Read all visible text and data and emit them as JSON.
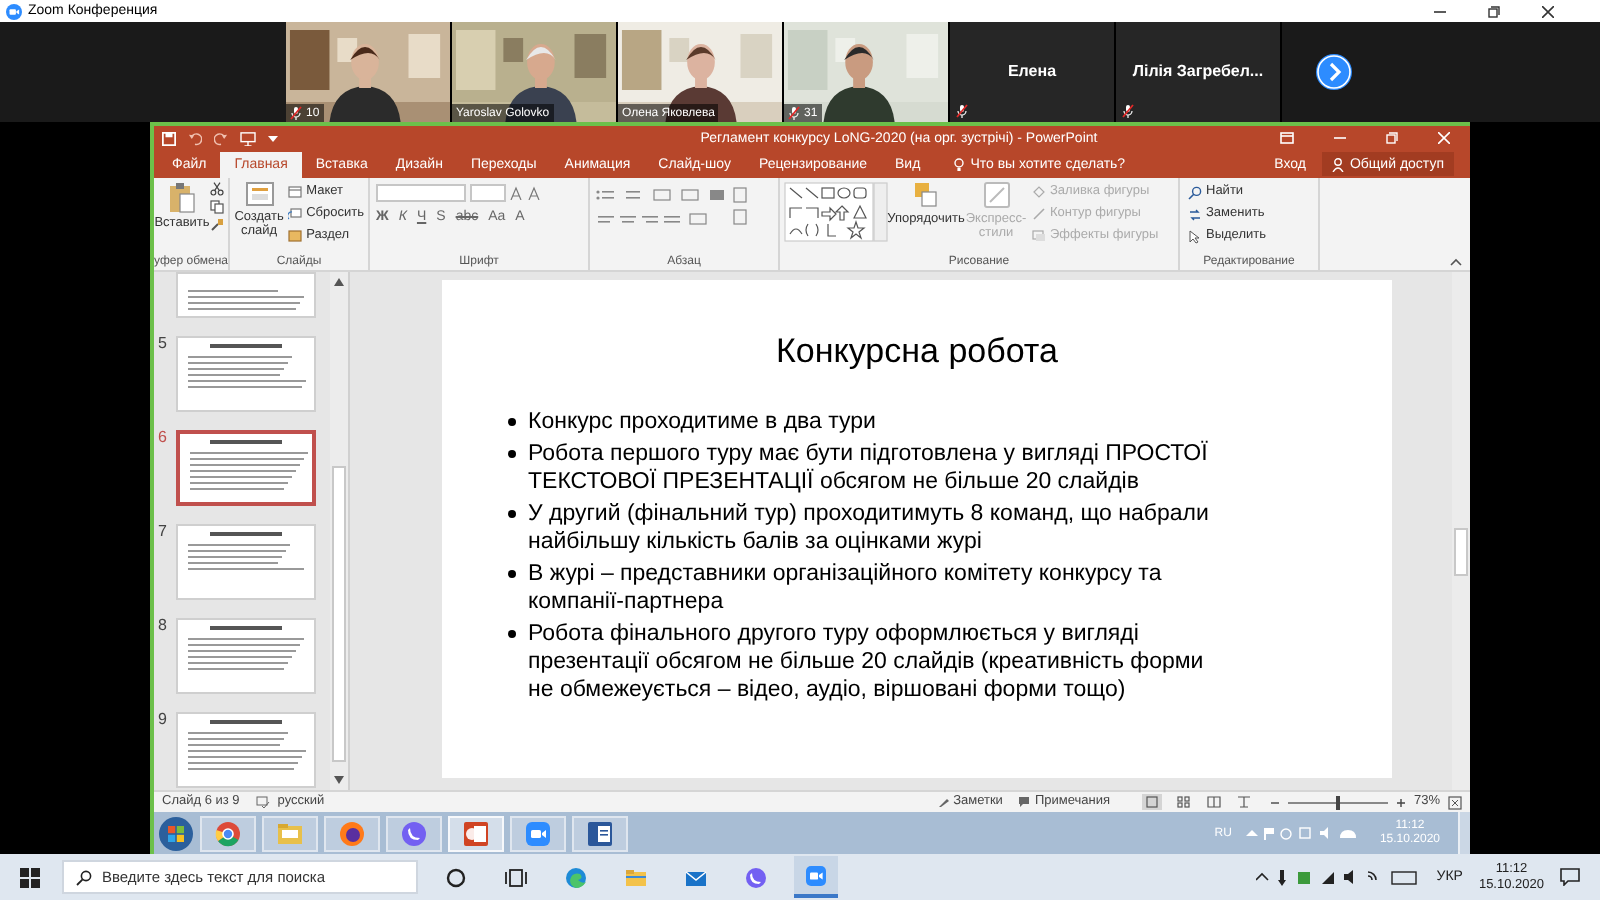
{
  "zoom_window": {
    "title": "Zoom Конференция"
  },
  "participants": [
    {
      "name": "10",
      "muted": true,
      "kind": "video"
    },
    {
      "name": "Yaroslav Golovko",
      "muted": false,
      "kind": "video"
    },
    {
      "name": "Олена Яковлева",
      "muted": false,
      "kind": "video"
    },
    {
      "name": "31",
      "muted": true,
      "kind": "video"
    },
    {
      "name": "Елена",
      "muted": true,
      "kind": "name_only"
    },
    {
      "name": "Лілія Загребел...",
      "muted": true,
      "kind": "name_only"
    }
  ],
  "powerpoint": {
    "title": "Регламент конкурсу LoNG-2020 (на орг. зустрічі) - PowerPoint",
    "tabs": [
      {
        "label": "Файл",
        "selected": false
      },
      {
        "label": "Главная",
        "selected": true
      },
      {
        "label": "Вставка",
        "selected": false
      },
      {
        "label": "Дизайн",
        "selected": false
      },
      {
        "label": "Переходы",
        "selected": false
      },
      {
        "label": "Анимация",
        "selected": false
      },
      {
        "label": "Слайд-шоу",
        "selected": false
      },
      {
        "label": "Рецензирование",
        "selected": false
      },
      {
        "label": "Вид",
        "selected": false
      }
    ],
    "tell_me": "Что вы хотите сделать?",
    "sign_in": "Вход",
    "share": "Общий доступ",
    "ribbon": {
      "clipboard": {
        "label": "уфер обмена",
        "paste": "Вставить"
      },
      "slides": {
        "label": "Слайды",
        "new_slide": "Создать слайд",
        "buttons": [
          "Макет",
          "Сбросить",
          "Раздел"
        ]
      },
      "font": {
        "label": "Шрифт",
        "buttons": [
          "Ж",
          "К",
          "Ч",
          "S",
          "abc",
          "Aa",
          "A"
        ]
      },
      "paragraph": {
        "label": "Абзац"
      },
      "drawing": {
        "label": "Рисование",
        "arrange": "Упорядочить",
        "quick_styles": {
          "label": "Экспресс-стили",
          "disabled": true
        },
        "shape_options": [
          {
            "label": "Заливка фигуры",
            "disabled": true
          },
          {
            "label": "Контур фигуры",
            "disabled": true
          },
          {
            "label": "Эффекты фигуры",
            "disabled": true
          }
        ]
      },
      "editing": {
        "label": "Редактирование",
        "buttons": [
          "Найти",
          "Заменить",
          "Выделить"
        ]
      }
    },
    "thumbnails": [
      {
        "selected": false
      },
      {
        "number": "5",
        "selected": false
      },
      {
        "number": "6",
        "selected": true
      },
      {
        "number": "7",
        "selected": false
      },
      {
        "number": "8",
        "selected": false
      },
      {
        "number": "9",
        "selected": false
      }
    ],
    "slide": {
      "title": "Конкурсна робота",
      "bullets": [
        "Конкурс проходитиме в два тури",
        "Робота першого туру має бути підготовлена у вигляді ПРОСТОЇ ТЕКСТОВОЇ ПРЕЗЕНТАЦІЇ обсягом не більше 20 слайдів",
        "У другий (фінальний тур) проходитимуть 8 команд, що набрали найбільшу кількість балів за оцінками журі",
        "В журі – представники організаційного комітету конкурсу та компанії-партнера",
        "Робота фінального другого туру оформлюється у вигляді презентації обсягом не більше 20 слайдів (креативність форми не обмежеується – відео, аудіо, віршовані форми тощо)"
      ]
    },
    "status_bar": {
      "slide_counter": "Слайд 6 из 9",
      "language": "русский",
      "notes": "Заметки",
      "comments": "Примечания",
      "zoom": "73%",
      "zoom_slider": {
        "level": 0.5
      }
    }
  },
  "remote_taskbar": {
    "input_language": "RU",
    "time": "11:12",
    "date": "15.10.2020"
  },
  "taskbar": {
    "search_placeholder": "Введите здесь текст для поиска",
    "input_language": "УКР",
    "time": "11:12",
    "date": "15.10.2020"
  }
}
